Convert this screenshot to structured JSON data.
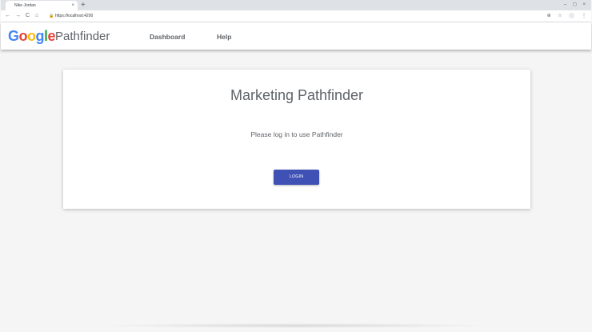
{
  "browser": {
    "tab_title": "Nike Jordan",
    "tab_close": "×",
    "new_tab": "+",
    "window_controls": "– ◻ ×",
    "back": "←",
    "forward": "→",
    "reload": "C",
    "home": "⌂",
    "lock": "🔒",
    "url": "https://localhost:4200",
    "extension_icon": "⊕",
    "star_icon": "☆",
    "menu_icon": "⋮"
  },
  "header": {
    "logo_letters": [
      {
        "ch": "G",
        "color": "#4285F4"
      },
      {
        "ch": "o",
        "color": "#EA4335"
      },
      {
        "ch": "o",
        "color": "#FBBC05"
      },
      {
        "ch": "g",
        "color": "#4285F4"
      },
      {
        "ch": "l",
        "color": "#34A853"
      },
      {
        "ch": "e",
        "color": "#EA4335"
      }
    ],
    "app_name": "Pathfinder",
    "nav": {
      "dashboard": "Dashboard",
      "help": "Help"
    }
  },
  "card": {
    "title": "Marketing Pathfinder",
    "message": "Please log in to use Pathfinder",
    "login_label": "LOGIN"
  },
  "colors": {
    "accent": "#3f51b5",
    "background": "#f5f5f5"
  }
}
